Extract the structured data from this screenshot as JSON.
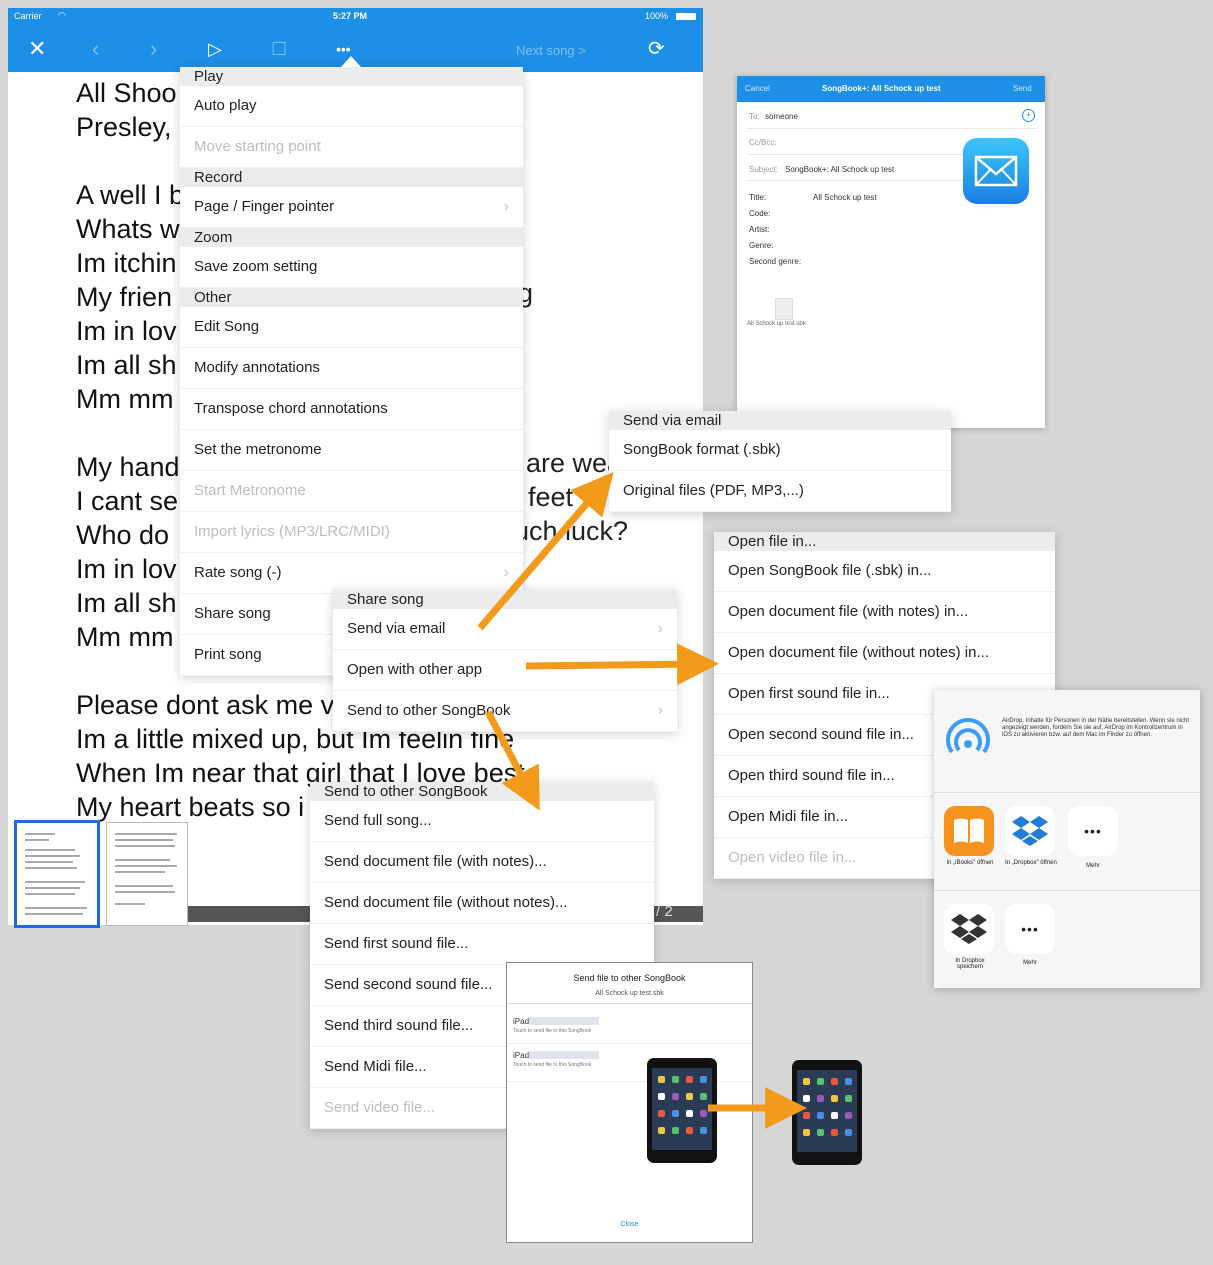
{
  "status_bar": {
    "carrier": "Carrier",
    "time": "5:27 PM",
    "battery": "100%"
  },
  "toolbar": {
    "close_icon": "close-icon",
    "back_icon": "chevron-left-icon",
    "forward_icon": "chevron-right-icon",
    "play_icon": "play-icon",
    "stop_icon": "square-icon",
    "more_icon": "more-icon",
    "next_song": "Next song  >",
    "search_icon": "search-refresh-icon"
  },
  "lyrics": {
    "lines": [
      "All Shoo",
      "Presley,",
      "",
      "A well I b",
      "Whats w",
      "Im itchin",
      "My frien",
      "Im in lov",
      "Im all sh",
      "Mm mm",
      "",
      "My hand",
      "I cant se",
      "Who do",
      "Im in lov",
      "Im all sh",
      "Mm mm",
      "",
      "Please dont ask me v",
      "Im a little mixed up, but Im feelin fine",
      "When Im near that girl that I love best",
      "My heart beats so i"
    ],
    "fragments": [
      "g",
      "are wea",
      "feet",
      "uch luck?"
    ]
  },
  "page_indicator": "/ 2",
  "main_menu": {
    "sections": [
      {
        "header": "Play",
        "items": [
          {
            "label": "Auto play",
            "enabled": true
          },
          {
            "label": "Move starting point",
            "enabled": false
          }
        ]
      },
      {
        "header": "Record",
        "items": [
          {
            "label": "Page / Finger pointer",
            "enabled": true,
            "chevron": true
          }
        ]
      },
      {
        "header": "Zoom",
        "items": [
          {
            "label": "Save zoom setting",
            "enabled": true
          }
        ]
      },
      {
        "header": "Other",
        "items": [
          {
            "label": "Edit Song",
            "enabled": true
          },
          {
            "label": "Modify annotations",
            "enabled": true
          },
          {
            "label": "Transpose chord annotations",
            "enabled": true
          },
          {
            "label": "Set the metronome",
            "enabled": true
          },
          {
            "label": "Start Metronome",
            "enabled": false
          },
          {
            "label": "Import lyrics (MP3/LRC/MIDI)",
            "enabled": false
          },
          {
            "label": "Rate song (-)",
            "enabled": true,
            "chevron": true
          },
          {
            "label": "Share song",
            "enabled": true
          },
          {
            "label": "Print song",
            "enabled": true
          }
        ]
      }
    ]
  },
  "share_menu": {
    "header": "Share song",
    "items": [
      {
        "label": "Send via email",
        "chevron": true
      },
      {
        "label": "Open with other app"
      },
      {
        "label": "Send to other SongBook",
        "chevron": true
      }
    ]
  },
  "email_menu": {
    "header": "Send via email",
    "items": [
      {
        "label": "SongBook format (.sbk)"
      },
      {
        "label": "Original files (PDF, MP3,...)"
      }
    ]
  },
  "openin_menu": {
    "header": "Open file in...",
    "items": [
      {
        "label": "Open SongBook file (.sbk) in...",
        "enabled": true
      },
      {
        "label": "Open document file (with notes) in...",
        "enabled": true
      },
      {
        "label": "Open document file (without notes) in...",
        "enabled": true
      },
      {
        "label": "Open first sound file in...",
        "enabled": true
      },
      {
        "label": "Open second sound file in...",
        "enabled": true
      },
      {
        "label": "Open third sound file in...",
        "enabled": true
      },
      {
        "label": "Open Midi file in...",
        "enabled": true
      },
      {
        "label": "Open video file in...",
        "enabled": false
      }
    ]
  },
  "songbook_menu": {
    "header": "Send to other SongBook",
    "items": [
      {
        "label": "Send full song...",
        "enabled": true
      },
      {
        "label": "Send document file (with notes)...",
        "enabled": true
      },
      {
        "label": "Send document file (without notes)...",
        "enabled": true
      },
      {
        "label": "Send first sound file...",
        "enabled": true
      },
      {
        "label": "Send second sound file...",
        "enabled": true
      },
      {
        "label": "Send third sound file...",
        "enabled": true
      },
      {
        "label": "Send Midi file...",
        "enabled": true
      },
      {
        "label": "Send video file...",
        "enabled": false
      }
    ]
  },
  "email_compose": {
    "cancel": "Cancel",
    "title": "SongBook+: All Schock up test",
    "send": "Send",
    "to_label": "To:",
    "to_value": "someone",
    "cc_label": "Cc/Bcc:",
    "subject_label": "Subject:",
    "subject_value": "SongBook+: All Schock up test",
    "fields": [
      {
        "label": "Title:",
        "value": "All Schock up test"
      },
      {
        "label": "Code:",
        "value": ""
      },
      {
        "label": "Artist:",
        "value": ""
      },
      {
        "label": "Genre:",
        "value": ""
      },
      {
        "label": "Second genre:",
        "value": ""
      }
    ],
    "attachment": "All Schock up test.sbk",
    "mail_icon": "mail-icon"
  },
  "share_sheet": {
    "airdrop_icon": "airdrop-icon",
    "airdrop_text": "AirDrop. Inhalte für Personen in der Nähe bereitstellen. Wenn sie nicht angezeigt werden, fordern Sie sie auf, AirDrop im Kontrollzentrum in iOS zu aktivieren bzw. auf dem Mac im Finder zu öffnen.",
    "apps": [
      {
        "label": "In „iBooks\" öffnen",
        "icon": "ibooks-icon"
      },
      {
        "label": "In „Dropbox\" öffnen",
        "icon": "dropbox-icon"
      },
      {
        "label": "Mehr",
        "icon": "more-icon"
      }
    ],
    "actions": [
      {
        "label": "In Dropbox speichern",
        "icon": "dropbox-save-icon"
      },
      {
        "label": "Mehr",
        "icon": "more-icon"
      }
    ]
  },
  "send_file": {
    "title": "Send file to other SongBook",
    "subtitle": "All Schock up test.sbk",
    "devices": [
      {
        "name": "iPad",
        "hint": "Touch to send file to this SongBook"
      },
      {
        "name": "iPad",
        "hint": "Touch to send file to this SongBook"
      }
    ],
    "close": "Close"
  },
  "colors": {
    "accent": "#1d8fe6",
    "arrow": "#f39a1b",
    "header_bg": "#ececec",
    "disabled": "#bdbdbd"
  }
}
